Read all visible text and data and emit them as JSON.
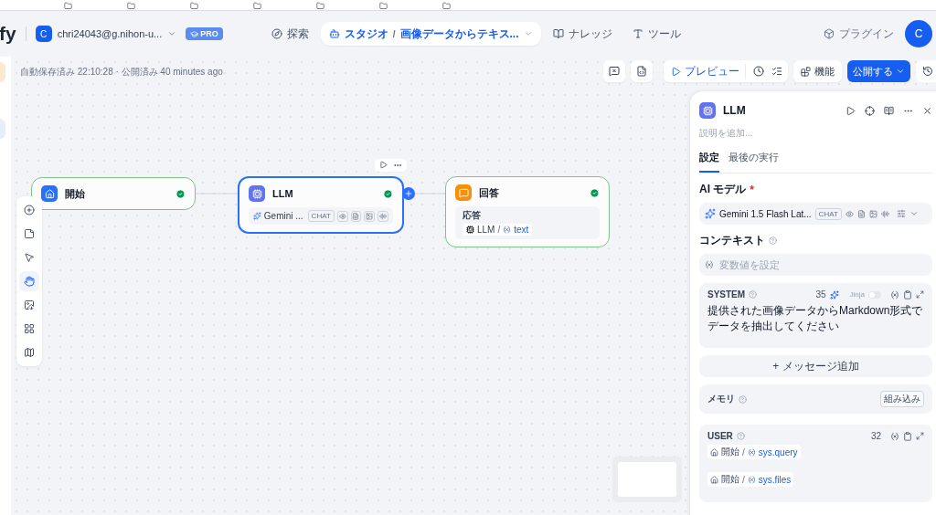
{
  "header": {
    "logo": "fy",
    "account": {
      "initial": "C",
      "email": "chri24043@g.nihon-u...",
      "badge": "PRO"
    },
    "nav": [
      {
        "label": "探索",
        "selected": false
      },
      {
        "label": "スタジオ",
        "selected": true,
        "separator": "/",
        "app": "画像データからテキス..."
      },
      {
        "label": "ナレッジ",
        "selected": false
      },
      {
        "label": "ツール",
        "selected": false
      }
    ],
    "plugins": "プラグイン",
    "avatar": "C"
  },
  "status": "自動保存済み 22:10:28 · 公開済み 40 minutes ago",
  "toolbar": {
    "preview": "プレビュー",
    "features": "機能",
    "publish": "公開する"
  },
  "tools": [
    {
      "kind": "add",
      "selected": false
    },
    {
      "kind": "note",
      "selected": false
    },
    {
      "kind": "pointer",
      "selected": false
    },
    {
      "kind": "hand",
      "selected": true
    },
    {
      "kind": "export",
      "selected": false
    },
    {
      "kind": "organize",
      "selected": false
    },
    {
      "kind": "minimap",
      "selected": false
    }
  ],
  "nodes": [
    {
      "kind": "start",
      "title": "開始",
      "selected": false
    },
    {
      "kind": "llm",
      "title": "LLM",
      "selected": true,
      "model": "Gemini ...",
      "model_tag": "CHAT"
    },
    {
      "kind": "answer",
      "title": "回答",
      "selected": false,
      "field_label": "応答",
      "source": "LLM",
      "separator": "/",
      "variable": "text"
    }
  ],
  "panel": {
    "title": "LLM",
    "description_placeholder": "説明を追加...",
    "tabs": [
      {
        "label": "設定",
        "selected": true
      },
      {
        "label": "最後の実行",
        "selected": false
      }
    ],
    "model_label": "AI モデル",
    "required_mark": "*",
    "model": "Gemini 1.5 Flash Lat...",
    "model_tag": "CHAT",
    "context_label": "コンテキスト",
    "context_placeholder": "変数値を設定",
    "system": {
      "label": "SYSTEM",
      "count": "35",
      "jinja": "Jinja",
      "jinja_on": false,
      "text": "提供された画像データからMarkdown形式でデータを抽出してください"
    },
    "add_message": "+ メッセージ追加",
    "memory": {
      "label": "メモリ",
      "badge": "組み込み"
    },
    "user": {
      "label": "USER",
      "count": "32",
      "vars": [
        {
          "node": "開始",
          "separator": "/",
          "name": "sys.query"
        },
        {
          "node": "開始",
          "separator": "/",
          "name": "sys.files"
        }
      ]
    }
  }
}
